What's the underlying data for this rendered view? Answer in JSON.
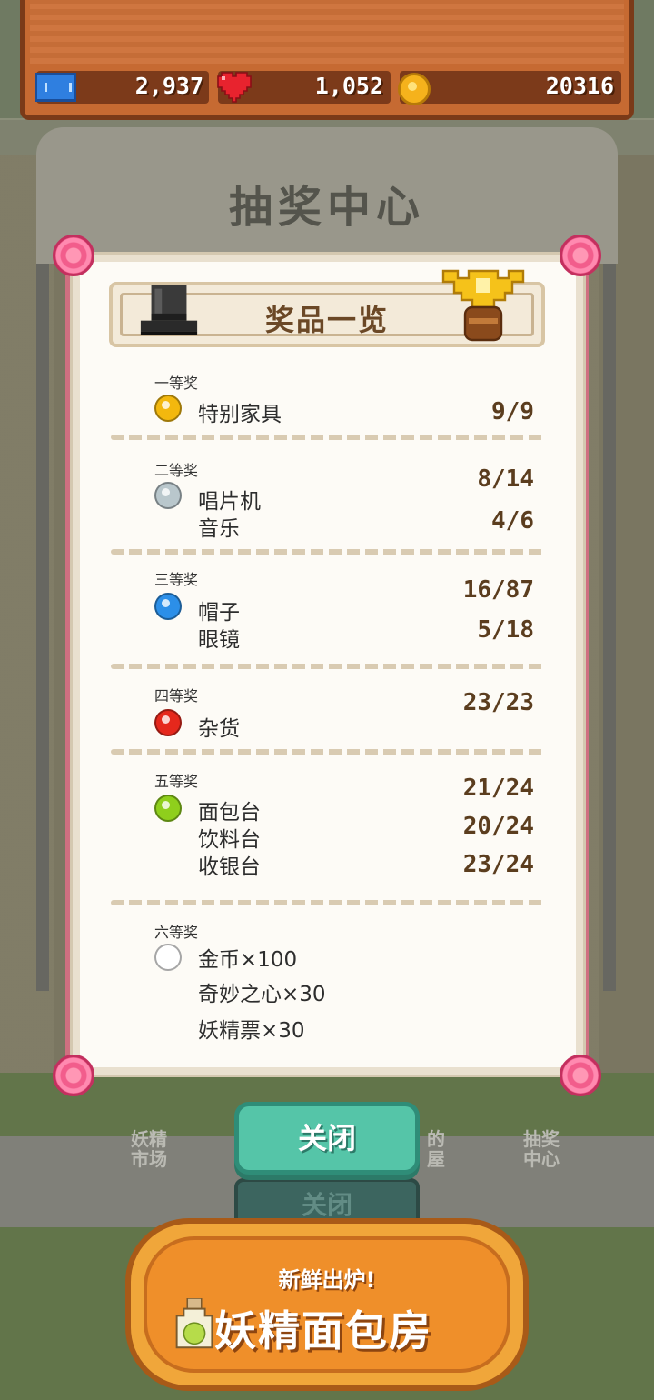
{
  "currency": {
    "tickets": "2,937",
    "hearts": "1,052",
    "coins": "20316"
  },
  "background": {
    "booth_title": "抽奖中心",
    "stall_left": "妖精\n市场",
    "stall_mid": "的\n屋",
    "stall_right": "抽奖\n中心",
    "ghost_close": "关闭"
  },
  "panel": {
    "title": "奖品一览",
    "tiers": [
      {
        "label": "一等奖",
        "orb_color": "#f3b80e",
        "items": [
          {
            "name": "特别家具",
            "count": "9/9"
          }
        ]
      },
      {
        "label": "二等奖",
        "orb_color": "#b9c7cc",
        "items": [
          {
            "name": "唱片机",
            "count": "8/14"
          },
          {
            "name": "音乐",
            "count": "4/6"
          }
        ]
      },
      {
        "label": "三等奖",
        "orb_color": "#2c8fe8",
        "items": [
          {
            "name": "帽子",
            "count": "16/87"
          },
          {
            "name": "眼镜",
            "count": "5/18"
          }
        ]
      },
      {
        "label": "四等奖",
        "orb_color": "#e5281c",
        "items": [
          {
            "name": "杂货",
            "count": "23/23"
          }
        ]
      },
      {
        "label": "五等奖",
        "orb_color": "#8fcf1c",
        "items": [
          {
            "name": "面包台",
            "count": "21/24"
          },
          {
            "name": "饮料台",
            "count": "20/24"
          },
          {
            "name": "收银台",
            "count": "23/24"
          }
        ]
      },
      {
        "label": "六等奖",
        "orb_color": "#ffffff",
        "items": [
          {
            "name": "金币×100"
          },
          {
            "name": "奇妙之心×30"
          },
          {
            "name": "妖精票×30"
          }
        ]
      }
    ]
  },
  "close_button": "关闭",
  "banner": {
    "subtitle": "新鲜出炉!",
    "title": "妖精面包房"
  }
}
